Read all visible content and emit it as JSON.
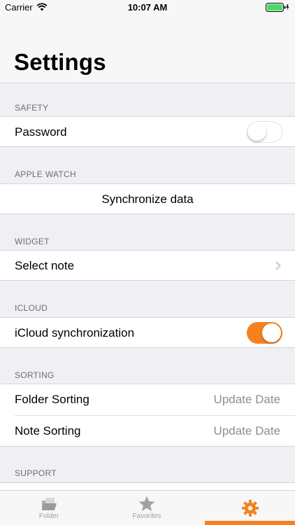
{
  "status_bar": {
    "carrier": "Carrier",
    "time": "10:07 AM",
    "battery_level": 1.0,
    "charging": true
  },
  "header": {
    "title": "Settings"
  },
  "sections": {
    "safety": {
      "header": "SAFETY",
      "password_label": "Password",
      "password_enabled": false
    },
    "apple_watch": {
      "header": "APPLE WATCH",
      "sync_label": "Synchronize data"
    },
    "widget": {
      "header": "WIDGET",
      "select_note_label": "Select note"
    },
    "icloud": {
      "header": "ICLOUD",
      "sync_label": "iCloud synchronization",
      "sync_enabled": true
    },
    "sorting": {
      "header": "SORTING",
      "folder_label": "Folder Sorting",
      "folder_value": "Update Date",
      "note_label": "Note Sorting",
      "note_value": "Update Date"
    },
    "support": {
      "header": "SUPPORT"
    }
  },
  "tab_bar": {
    "tabs": [
      {
        "label": "Folder",
        "icon": "folder-icon"
      },
      {
        "label": "Favorites",
        "icon": "star-icon"
      },
      {
        "label": "",
        "icon": "gear-icon"
      }
    ],
    "active_index": 2
  },
  "colors": {
    "accent": "#f5821f",
    "background": "#efeff4",
    "secondary_text": "#8e8e93"
  }
}
